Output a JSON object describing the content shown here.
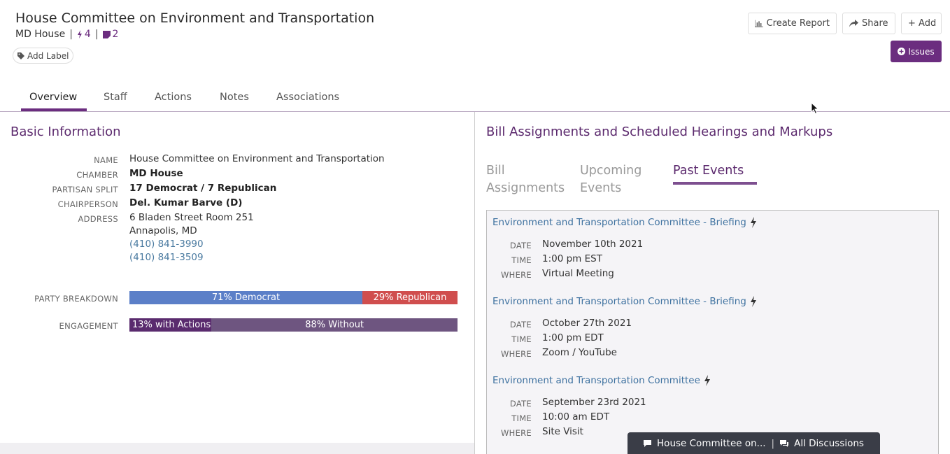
{
  "header": {
    "title": "House Committee on Environment and Transportation",
    "chamber": "MD House",
    "actions_count": "4",
    "notes_count": "2",
    "add_label": "Add Label",
    "separator": "|"
  },
  "toolbar": {
    "create_report": "Create Report",
    "share": "Share",
    "add": "+ Add",
    "issues": "Issues"
  },
  "tabs": [
    {
      "label": "Overview",
      "active": true
    },
    {
      "label": "Staff"
    },
    {
      "label": "Actions"
    },
    {
      "label": "Notes"
    },
    {
      "label": "Associations"
    }
  ],
  "basic_info": {
    "title": "Basic Information",
    "rows": [
      {
        "label": "NAME",
        "value": "House Committee on Environment and Transportation"
      },
      {
        "label": "CHAMBER",
        "value": "MD House"
      },
      {
        "label": "PARTISAN SPLIT",
        "value": "17 Democrat / 7 Republican"
      },
      {
        "label": "CHAIRPERSON",
        "value": "Del. Kumar Barve (D)"
      },
      {
        "label": "ADDRESS",
        "value": "6 Bladen Street Room 251"
      }
    ],
    "address_line2": "Annapolis, MD",
    "phone1": "(410) 841-3990",
    "phone2": "(410) 841-3509"
  },
  "party_breakdown": {
    "label": "PARTY BREAKDOWN",
    "democrat_text": "71% Democrat",
    "republican_text": "29% Republican",
    "democrat_fraction": 0.71,
    "republican_fraction": 0.29
  },
  "engagement": {
    "label": "ENGAGEMENT",
    "with_actions_text": "13% with Actions",
    "without_text": "88% Without",
    "with_actions_fraction": 0.25
  },
  "right_panel": {
    "title": "Bill Assignments and Scheduled Hearings and Markups",
    "subtabs": [
      {
        "line1": "Bill",
        "line2": "Assignments"
      },
      {
        "line1": "Upcoming",
        "line2": "Events"
      },
      {
        "label": "Past Events",
        "active": true
      }
    ],
    "field_labels": {
      "date": "DATE",
      "time": "TIME",
      "where": "WHERE"
    },
    "events": [
      {
        "title": "Environment and Transportation Committee - Briefing",
        "date": "November 10th 2021",
        "time": "1:00 pm EST",
        "where": "Virtual Meeting"
      },
      {
        "title": "Environment and Transportation Committee - Briefing",
        "date": "October 27th 2021",
        "time": "1:00 pm EDT",
        "where": "Zoom / YouTube"
      },
      {
        "title": "Environment and Transportation Committee",
        "date": "September 23rd 2021",
        "time": "10:00 am EDT",
        "where": "Site Visit"
      }
    ]
  },
  "discussions": {
    "current": "House Committee on...",
    "separator": "|",
    "all": "All Discussions"
  },
  "colors": {
    "brand_purple": "#6b2d7f",
    "democrat": "#5b7fc8",
    "republican": "#d04e4e",
    "link": "#3f72a0"
  }
}
